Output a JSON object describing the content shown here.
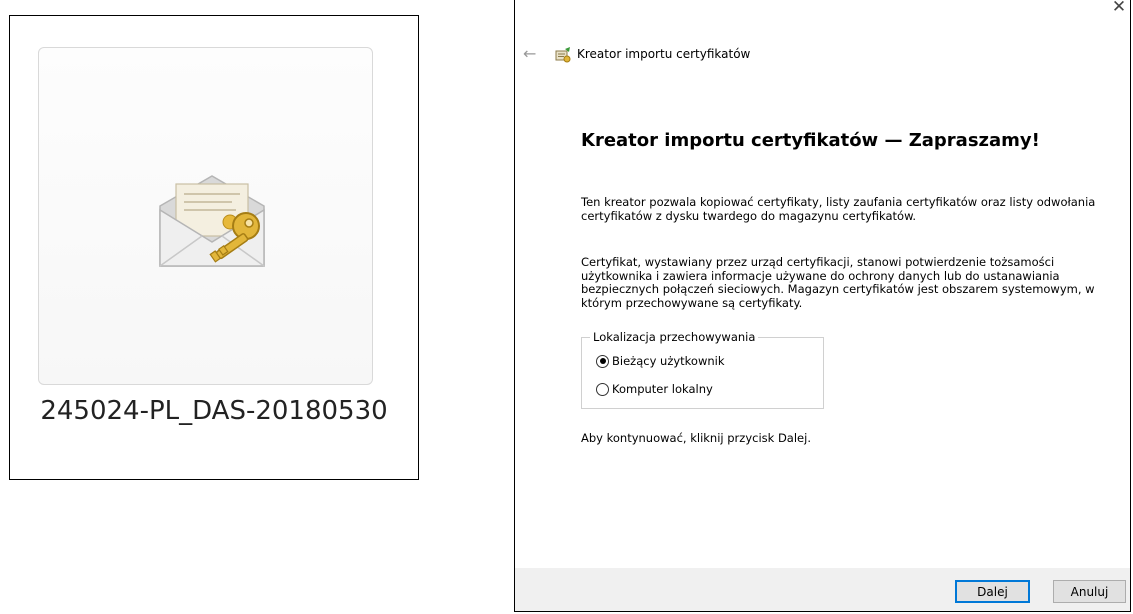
{
  "file": {
    "name": "245024-PL_DAS-20180530",
    "icon": "certificate-envelope-key-icon"
  },
  "wizard": {
    "window_title": "Kreator importu certyfikatów",
    "close_label": "✕",
    "back_label": "←",
    "heading": "Kreator importu certyfikatów — Zapraszamy!",
    "intro": "Ten kreator pozwala kopiować certyfikaty, listy zaufania certyfikatów oraz listy odwołania certyfikatów z dysku twardego do magazynu certyfikatów.",
    "description": "Certyfikat, wystawiany przez urząd certyfikacji, stanowi potwierdzenie tożsamości użytkownika i zawiera informacje używane do ochrony danych lub do ustanawiania bezpiecznych połączeń sieciowych. Magazyn certyfikatów jest obszarem systemowym, w którym przechowywane są certyfikaty.",
    "storage": {
      "legend": "Lokalizacja przechowywania",
      "options": [
        {
          "label": "Bieżący użytkownik",
          "selected": true
        },
        {
          "label": "Komputer lokalny",
          "selected": false
        }
      ]
    },
    "continue_text": "Aby kontynuować, kliknij przycisk Dalej.",
    "buttons": {
      "next": "Dalej",
      "cancel": "Anuluj"
    }
  },
  "colors": {
    "default_button_border": "#0078d7",
    "footer_bg": "#f0f0f0"
  }
}
